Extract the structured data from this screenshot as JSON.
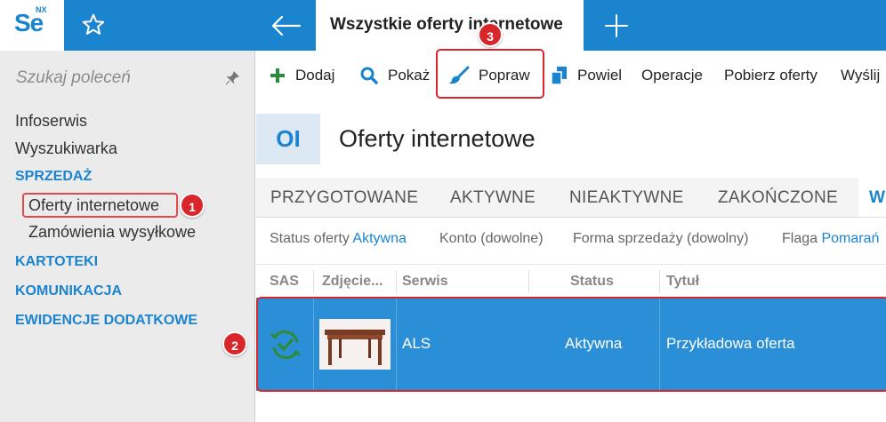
{
  "app": {
    "logo_text": "Se",
    "logo_sup": "NX",
    "tab_title": "Wszystkie oferty internetowe"
  },
  "sidebar": {
    "search_placeholder": "Szukaj poleceń",
    "items": [
      {
        "label": "Infoserwis",
        "type": "link"
      },
      {
        "label": "Wyszukiwarka",
        "type": "link"
      },
      {
        "label": "SPRZEDAŻ",
        "type": "section"
      },
      {
        "label": "Oferty internetowe",
        "type": "subitem",
        "selected": true
      },
      {
        "label": "Zamówienia wysyłkowe",
        "type": "subitem"
      },
      {
        "label": "KARTOTEKI",
        "type": "section"
      },
      {
        "label": "KOMUNIKACJA",
        "type": "section"
      },
      {
        "label": "EWIDENCJE DODATKOWE",
        "type": "section"
      }
    ]
  },
  "toolbar": {
    "dodaj": "Dodaj",
    "pokaz": "Pokaż",
    "popraw": "Popraw",
    "powiel": "Powiel",
    "operacje": "Operacje",
    "pobierz": "Pobierz oferty",
    "wyslij": "Wyślij"
  },
  "header": {
    "badge": "OI",
    "title": "Oferty internetowe"
  },
  "status_tabs": [
    "PRZYGOTOWANE",
    "AKTYWNE",
    "NIEAKTYWNE",
    "ZAKOŃCZONE",
    "W"
  ],
  "filters": {
    "status_label": "Status oferty",
    "status_value": "Aktywna",
    "konto": "Konto (dowolne)",
    "forma": "Forma sprzedaży (dowolny)",
    "flaga_label": "Flaga",
    "flaga_value": "Pomarań"
  },
  "grid": {
    "columns": [
      "SAS",
      "Zdjęcie...",
      "Serwis",
      "Status",
      "Tytuł"
    ],
    "rows": [
      {
        "serwis": "ALS",
        "status": "Aktywna",
        "tytul": "Przykładowa oferta"
      }
    ]
  },
  "callouts": {
    "one": "1",
    "two": "2",
    "three": "3"
  },
  "colors": {
    "accent": "#1b84cf",
    "selected_row": "#2a8fd6",
    "callout": "#d9262b",
    "sas_green": "#2e8b3e"
  }
}
